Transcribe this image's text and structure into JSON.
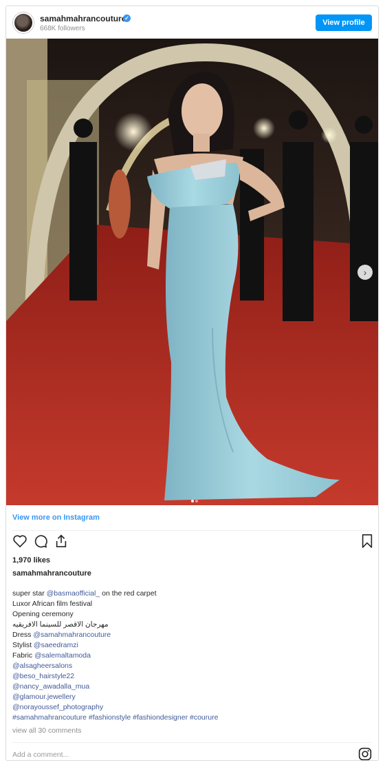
{
  "header": {
    "username": "samahmahrancouture",
    "verified_symbol": "✓",
    "followers": "668K followers",
    "view_profile_label": "View profile"
  },
  "photo": {
    "alt": "Woman in light blue gown on red carpet",
    "carousel": {
      "current": 1,
      "total": 2
    },
    "next_symbol": "›"
  },
  "view_more_label": "View more on Instagram",
  "actions": {
    "like_icon": "heart-icon",
    "comment_icon": "comment-icon",
    "share_icon": "share-icon",
    "save_icon": "bookmark-icon"
  },
  "likes": "1,970 likes",
  "owner": "samahmahrancouture",
  "caption": [
    {
      "pre": "super star ",
      "link": "@basmaofficial_",
      "post": " on the red carpet"
    },
    {
      "pre": "Luxor African film festival",
      "link": "",
      "post": ""
    },
    {
      "pre": "Opening ceremony",
      "link": "",
      "post": ""
    },
    {
      "pre": "مهرجان الاقصر للسينما الافريقيه",
      "link": "",
      "post": ""
    },
    {
      "pre": "Dress ",
      "link": "@samahmahrancouture",
      "post": ""
    },
    {
      "pre": "Stylist ",
      "link": "@saeedramzi",
      "post": ""
    },
    {
      "pre": "Fabric ",
      "link": "@salemaltamoda",
      "post": ""
    },
    {
      "pre": "",
      "link": "@alsagheersalons",
      "post": ""
    },
    {
      "pre": "",
      "link": "@beso_hairstyle22",
      "post": ""
    },
    {
      "pre": "",
      "link": "@nancy_awadalla_mua",
      "post": ""
    },
    {
      "pre": "",
      "link": "@glamour.jewellery",
      "post": ""
    },
    {
      "pre": "",
      "link": "@norayoussef_photography",
      "post": ""
    },
    {
      "pre": "",
      "link": "#samahmahrancouture #fashionstyle #fashiondesigner #courure",
      "post": ""
    }
  ],
  "comments_link": "view all 30 comments",
  "add_comment_placeholder": "Add a comment...",
  "colors": {
    "accent": "#0095f6",
    "link": "#3f5a99",
    "muted": "#8e8e8e"
  }
}
